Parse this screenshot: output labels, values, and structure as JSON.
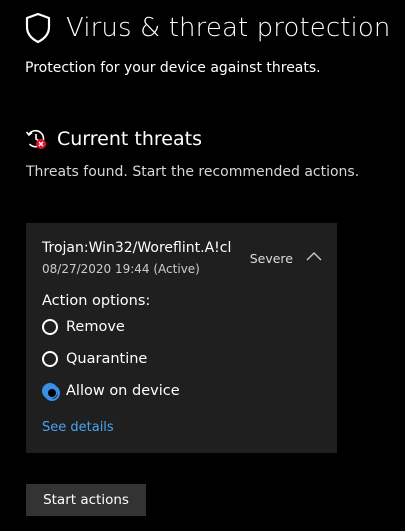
{
  "header": {
    "title": "Virus & threat protection",
    "subtitle": "Protection for your device against threats.",
    "icon": "shield-icon"
  },
  "current_threats": {
    "title": "Current threats",
    "description": "Threats found. Start the recommended actions.",
    "icon": "threat-history-icon"
  },
  "threat": {
    "name": "Trojan:Win32/Woreflint.A!cl",
    "meta": "08/27/2020 19:44 (Active)",
    "severity": "Severe",
    "action_label": "Action options:",
    "options": [
      {
        "label": "Remove",
        "checked": false
      },
      {
        "label": "Quarantine",
        "checked": false
      },
      {
        "label": "Allow on device",
        "checked": true
      }
    ],
    "details_link": "See details"
  },
  "start_button": "Start actions",
  "colors": {
    "background": "#000000",
    "card": "#1f1f1f",
    "accent": "#3a8ee6",
    "link": "#4aa3f0",
    "threat_red": "#e81123"
  }
}
